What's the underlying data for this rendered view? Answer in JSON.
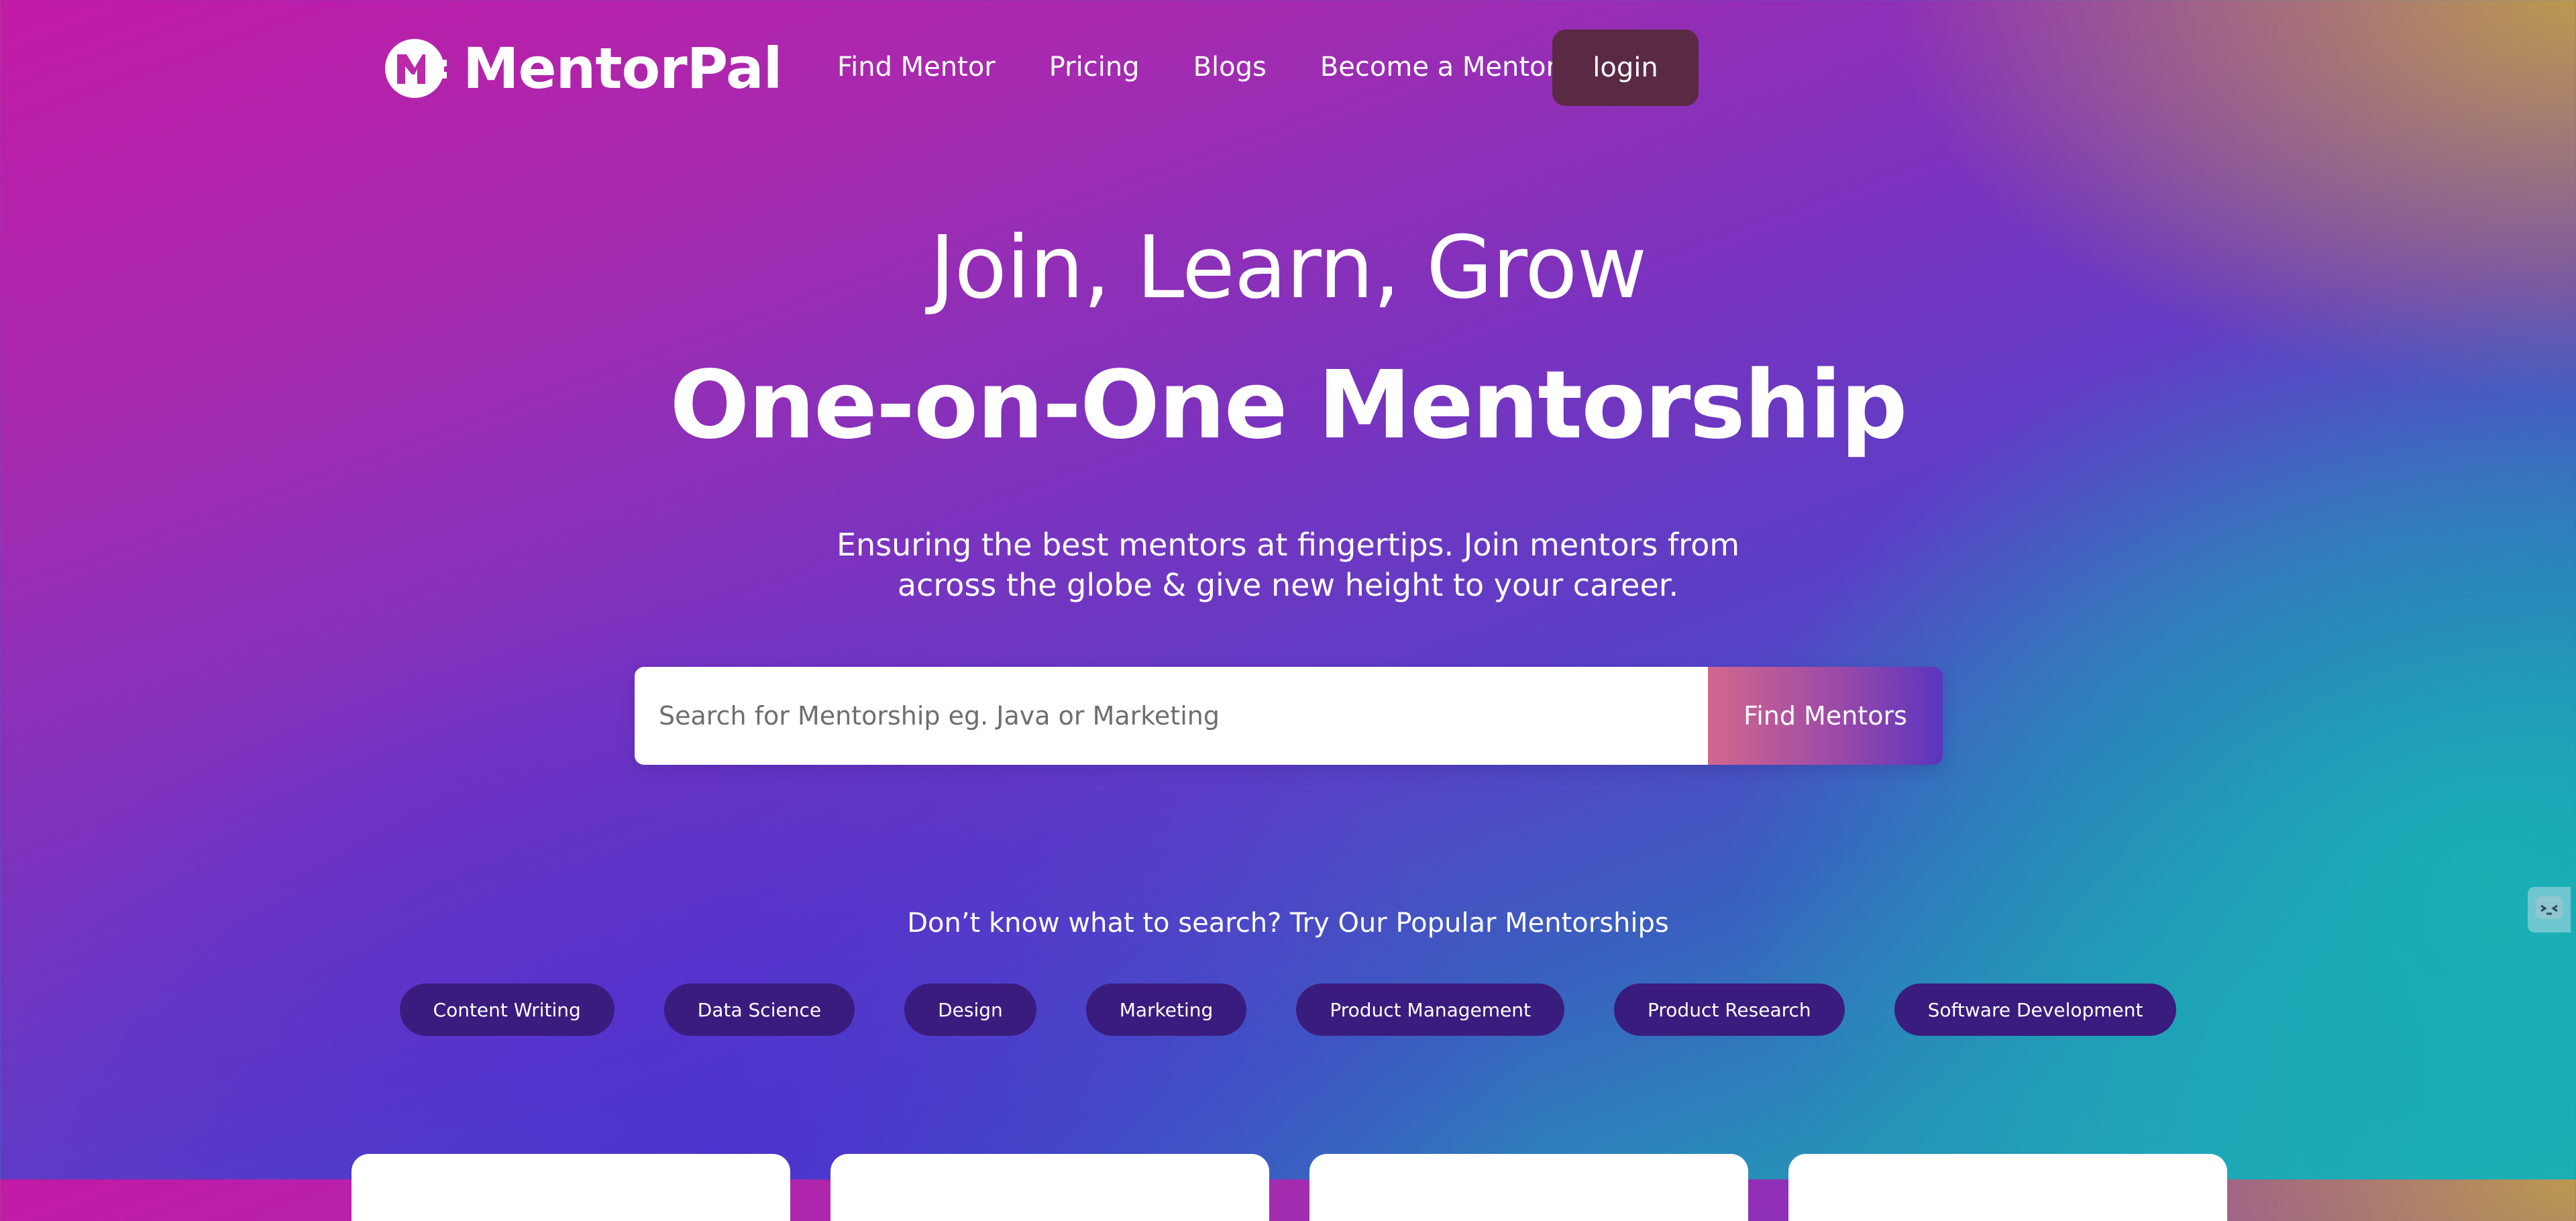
{
  "brand": {
    "name": "MentorPal",
    "logo_icon": "mentorpal-logo-icon"
  },
  "nav": {
    "items": [
      {
        "label": "Find Mentor"
      },
      {
        "label": "Pricing"
      },
      {
        "label": "Blogs"
      },
      {
        "label": "Become a Mentor"
      }
    ],
    "login_label": "login"
  },
  "hero": {
    "title": "Join, Learn, Grow",
    "subtitle": "One-on-One Mentorship",
    "description_line1": "Ensuring the best mentors at fingertips. Join mentors from",
    "description_line2": "across the globe & give new height to your career."
  },
  "search": {
    "placeholder": "Search for Mentorship eg. Java or Marketing",
    "value": "",
    "button_label": "Find Mentors"
  },
  "popular": {
    "label": "Don’t know what to search? Try Our Popular Mentorships",
    "chips": [
      {
        "label": "Content Writing"
      },
      {
        "label": "Data Science"
      },
      {
        "label": "Design"
      },
      {
        "label": "Marketing"
      },
      {
        "label": "Product Management"
      },
      {
        "label": "Product Research"
      },
      {
        "label": "Software Development"
      }
    ]
  },
  "side_widget": {
    "icon": "chat-widget-icon"
  },
  "colors": {
    "login_bg": "#5a2a44",
    "chip_bg": "#3a1c7e",
    "search_button_gradient_start": "#d2678c",
    "search_button_gradient_end": "#5a34c0",
    "background_magenta": "#c21aa6",
    "background_teal": "#22a9b6",
    "background_gold": "#c8aa3c"
  }
}
